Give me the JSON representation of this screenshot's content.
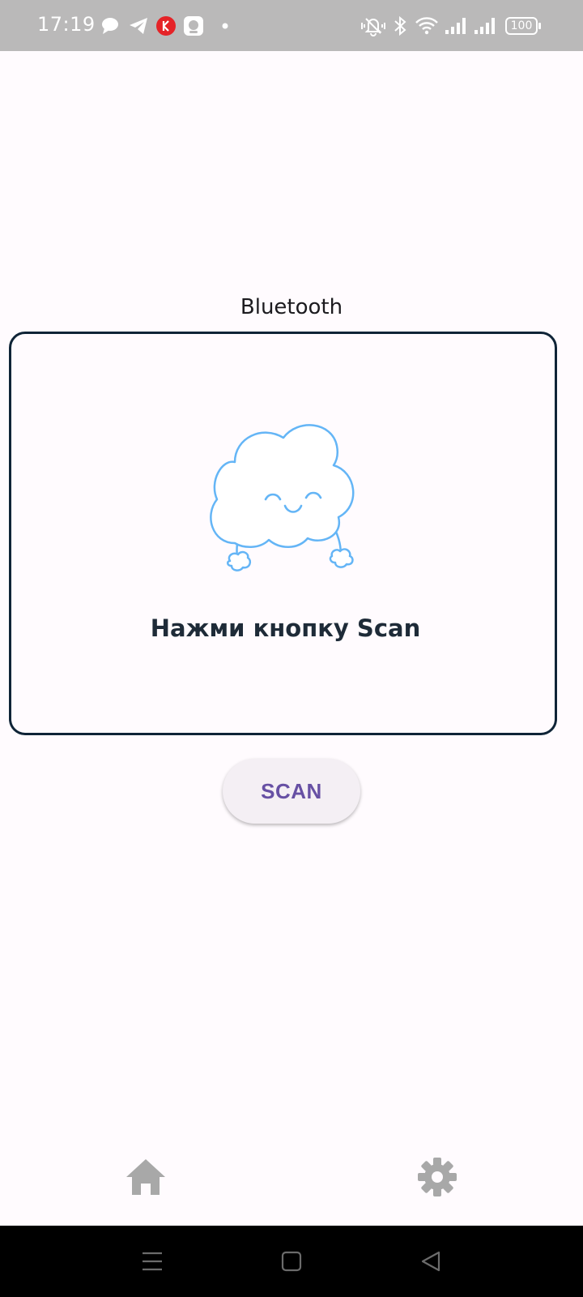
{
  "status_bar": {
    "time": "17:19",
    "battery": "100",
    "left_icons": [
      "chat-bubble-icon",
      "telegram-icon",
      "kaspersky-icon",
      "camera-app-icon",
      "dot-icon"
    ],
    "right_icons": [
      "vibrate-silent-icon",
      "bluetooth-icon",
      "wifi-icon",
      "signal-icon",
      "signal-icon",
      "battery-icon"
    ]
  },
  "main": {
    "title": "Bluetooth",
    "empty_state_text": "Нажми кнопку Scan",
    "scan_button": "SCAN"
  },
  "bottom_nav": {
    "items": [
      {
        "icon": "home-icon"
      },
      {
        "icon": "gear-icon"
      }
    ]
  },
  "system_nav": {
    "buttons": [
      "menu-icon",
      "home-square-icon",
      "back-triangle-icon"
    ]
  },
  "colors": {
    "background": "#fffbfe",
    "status_bar": "#bab9b9",
    "card_border": "#0f2437",
    "cloud_stroke": "#64b5f6",
    "button_text": "#6750a4",
    "button_bg": "#f4eff4",
    "nav_icon": "#a8a8a8",
    "system_nav": "#000000"
  }
}
